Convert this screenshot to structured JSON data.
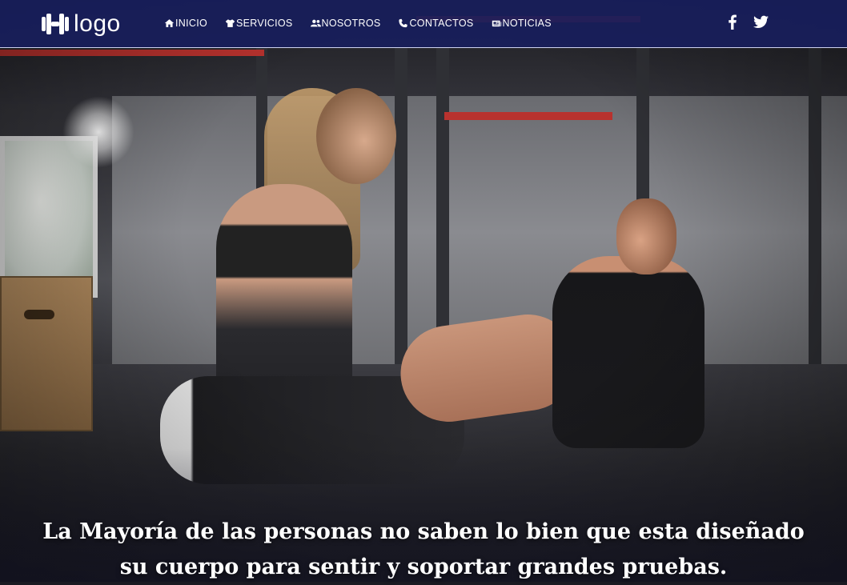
{
  "brand": {
    "logo_text": "logo",
    "icon": "dumbbell-h-icon"
  },
  "nav": {
    "items": [
      {
        "label": "INICIO",
        "icon": "home-icon"
      },
      {
        "label": "SERVICIOS",
        "icon": "shirt-icon"
      },
      {
        "label": "NOSOTROS",
        "icon": "users-icon"
      },
      {
        "label": "CONTACTOS",
        "icon": "phone-icon"
      },
      {
        "label": "NOTICIAS",
        "icon": "newspaper-icon"
      }
    ]
  },
  "social": [
    {
      "name": "facebook",
      "icon": "facebook-icon"
    },
    {
      "name": "twitter",
      "icon": "twitter-icon"
    }
  ],
  "hero": {
    "line1": "La Mayoría de las personas no saben lo bien que esta diseñado",
    "line2": "su cuerpo para sentir y soportar grandes pruebas.",
    "image": "gym-couple-workout-photo"
  },
  "colors": {
    "navbar": "#181e5c",
    "text": "#ffffff",
    "accent_red": "#b8322e"
  }
}
